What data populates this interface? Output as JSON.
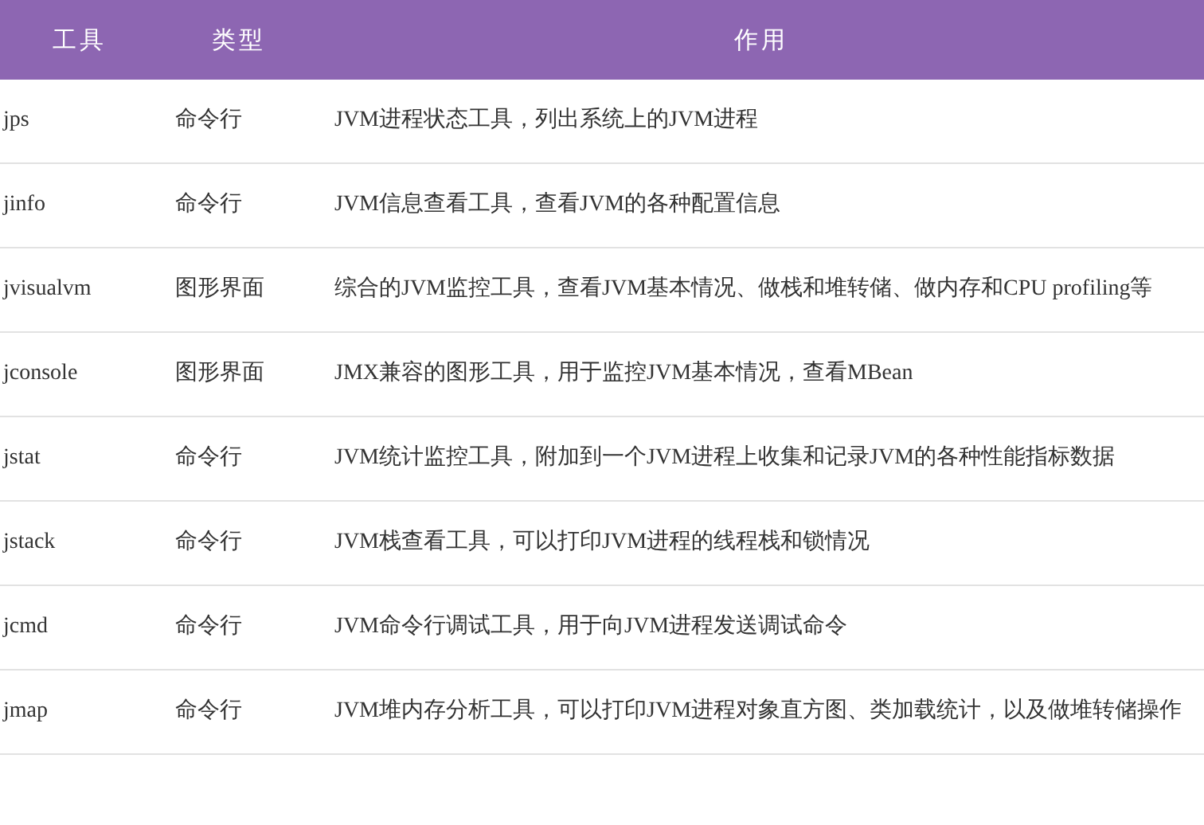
{
  "table": {
    "columns": [
      "工具",
      "类型",
      "作用"
    ],
    "rows": [
      {
        "tool": "jps",
        "type": "命令行",
        "use": "JVM进程状态工具，列出系统上的JVM进程"
      },
      {
        "tool": "jinfo",
        "type": "命令行",
        "use": "JVM信息查看工具，查看JVM的各种配置信息"
      },
      {
        "tool": "jvisualvm",
        "type": "图形界面",
        "use": "综合的JVM监控工具，查看JVM基本情况、做栈和堆转储、做内存和CPU profiling等"
      },
      {
        "tool": "jconsole",
        "type": "图形界面",
        "use": "JMX兼容的图形工具，用于监控JVM基本情况，查看MBean"
      },
      {
        "tool": "jstat",
        "type": "命令行",
        "use": "JVM统计监控工具，附加到一个JVM进程上收集和记录JVM的各种性能指标数据"
      },
      {
        "tool": "jstack",
        "type": "命令行",
        "use": "JVM栈查看工具，可以打印JVM进程的线程栈和锁情况"
      },
      {
        "tool": "jcmd",
        "type": "命令行",
        "use": "JVM命令行调试工具，用于向JVM进程发送调试命令"
      },
      {
        "tool": "jmap",
        "type": "命令行",
        "use": "JVM堆内存分析工具，可以打印JVM进程对象直方图、类加载统计，以及做堆转储操作"
      }
    ]
  }
}
